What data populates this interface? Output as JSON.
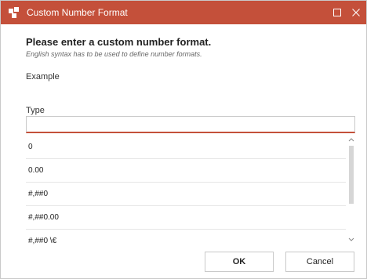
{
  "window": {
    "title": "Custom Number Format",
    "accent_color": "#c4503a",
    "icons": {
      "app": "app-icon",
      "maximize": "maximize-icon",
      "close": "close-icon"
    }
  },
  "dialog": {
    "heading": "Please enter a custom number format.",
    "subtext": "English syntax has to be used to define number formats.",
    "example_label": "Example",
    "type_label": "Type",
    "type_value": "",
    "formats": [
      "0",
      "0.00",
      "#,##0",
      "#,##0.00",
      "#,##0 \\€"
    ],
    "ok_label": "OK",
    "cancel_label": "Cancel"
  }
}
